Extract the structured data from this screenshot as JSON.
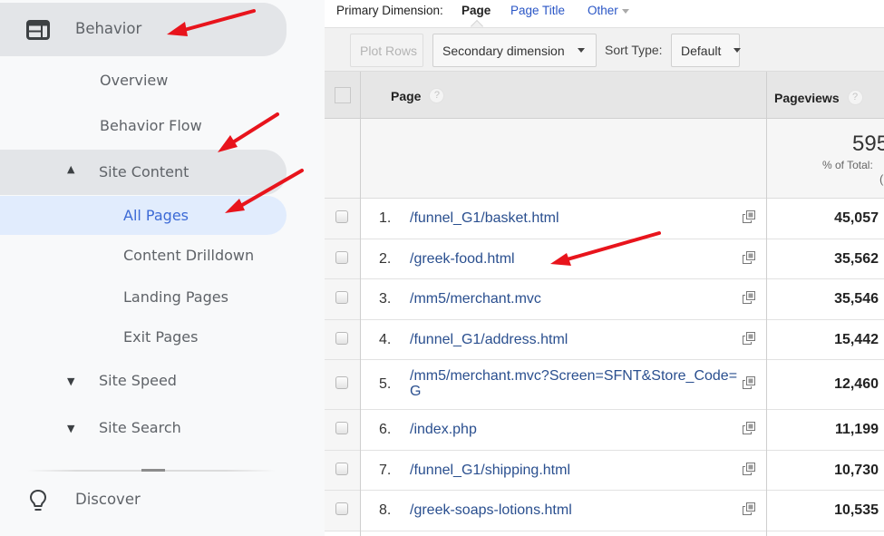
{
  "sidebar": {
    "section": {
      "label": "Behavior",
      "icon": "behavior-icon"
    },
    "items": [
      {
        "label": "Overview"
      },
      {
        "label": "Behavior Flow"
      }
    ],
    "site_content": {
      "label": "Site Content",
      "caret": "▲",
      "children": [
        {
          "label": "All Pages",
          "active": true
        },
        {
          "label": "Content Drilldown"
        },
        {
          "label": "Landing Pages"
        },
        {
          "label": "Exit Pages"
        }
      ]
    },
    "collapsed": [
      {
        "label": "Site Speed",
        "caret": "▼"
      },
      {
        "label": "Site Search",
        "caret": "▼"
      }
    ],
    "discover": {
      "label": "Discover",
      "icon": "lightbulb-icon"
    }
  },
  "dimension_bar": {
    "label": "Primary Dimension:",
    "current": "Page",
    "links": [
      "Page Title",
      "Other"
    ]
  },
  "toolbar": {
    "plot_rows": "Plot Rows",
    "secondary_dimension": "Secondary dimension",
    "sort_type_label": "Sort Type:",
    "sort_type_value": "Default"
  },
  "table": {
    "columns": {
      "page": "Page",
      "pageviews": "Pageviews",
      "help": "?"
    },
    "totals": {
      "pageviews": "595",
      "pct_label": "% of Total:",
      "paren": "("
    },
    "rows": [
      {
        "num": "1.",
        "page": "/funnel_G1/basket.html",
        "pageviews": "45,057"
      },
      {
        "num": "2.",
        "page": "/greek-food.html",
        "pageviews": "35,562"
      },
      {
        "num": "3.",
        "page": "/mm5/merchant.mvc",
        "pageviews": "35,546"
      },
      {
        "num": "4.",
        "page": "/funnel_G1/address.html",
        "pageviews": "15,442"
      },
      {
        "num": "5.",
        "page": "/mm5/merchant.mvc?Screen=SFNT&Store_Code=G",
        "pageviews": "12,460"
      },
      {
        "num": "6.",
        "page": "/index.php",
        "pageviews": "11,199"
      },
      {
        "num": "7.",
        "page": "/funnel_G1/shipping.html",
        "pageviews": "10,730"
      },
      {
        "num": "8.",
        "page": "/greek-soaps-lotions.html",
        "pageviews": "10,535"
      }
    ]
  },
  "colors": {
    "accent": "#3c6ad6",
    "link": "#2a4f8f",
    "annotation_arrow": "#e8141c",
    "active_bg": "#e1ecfd"
  }
}
